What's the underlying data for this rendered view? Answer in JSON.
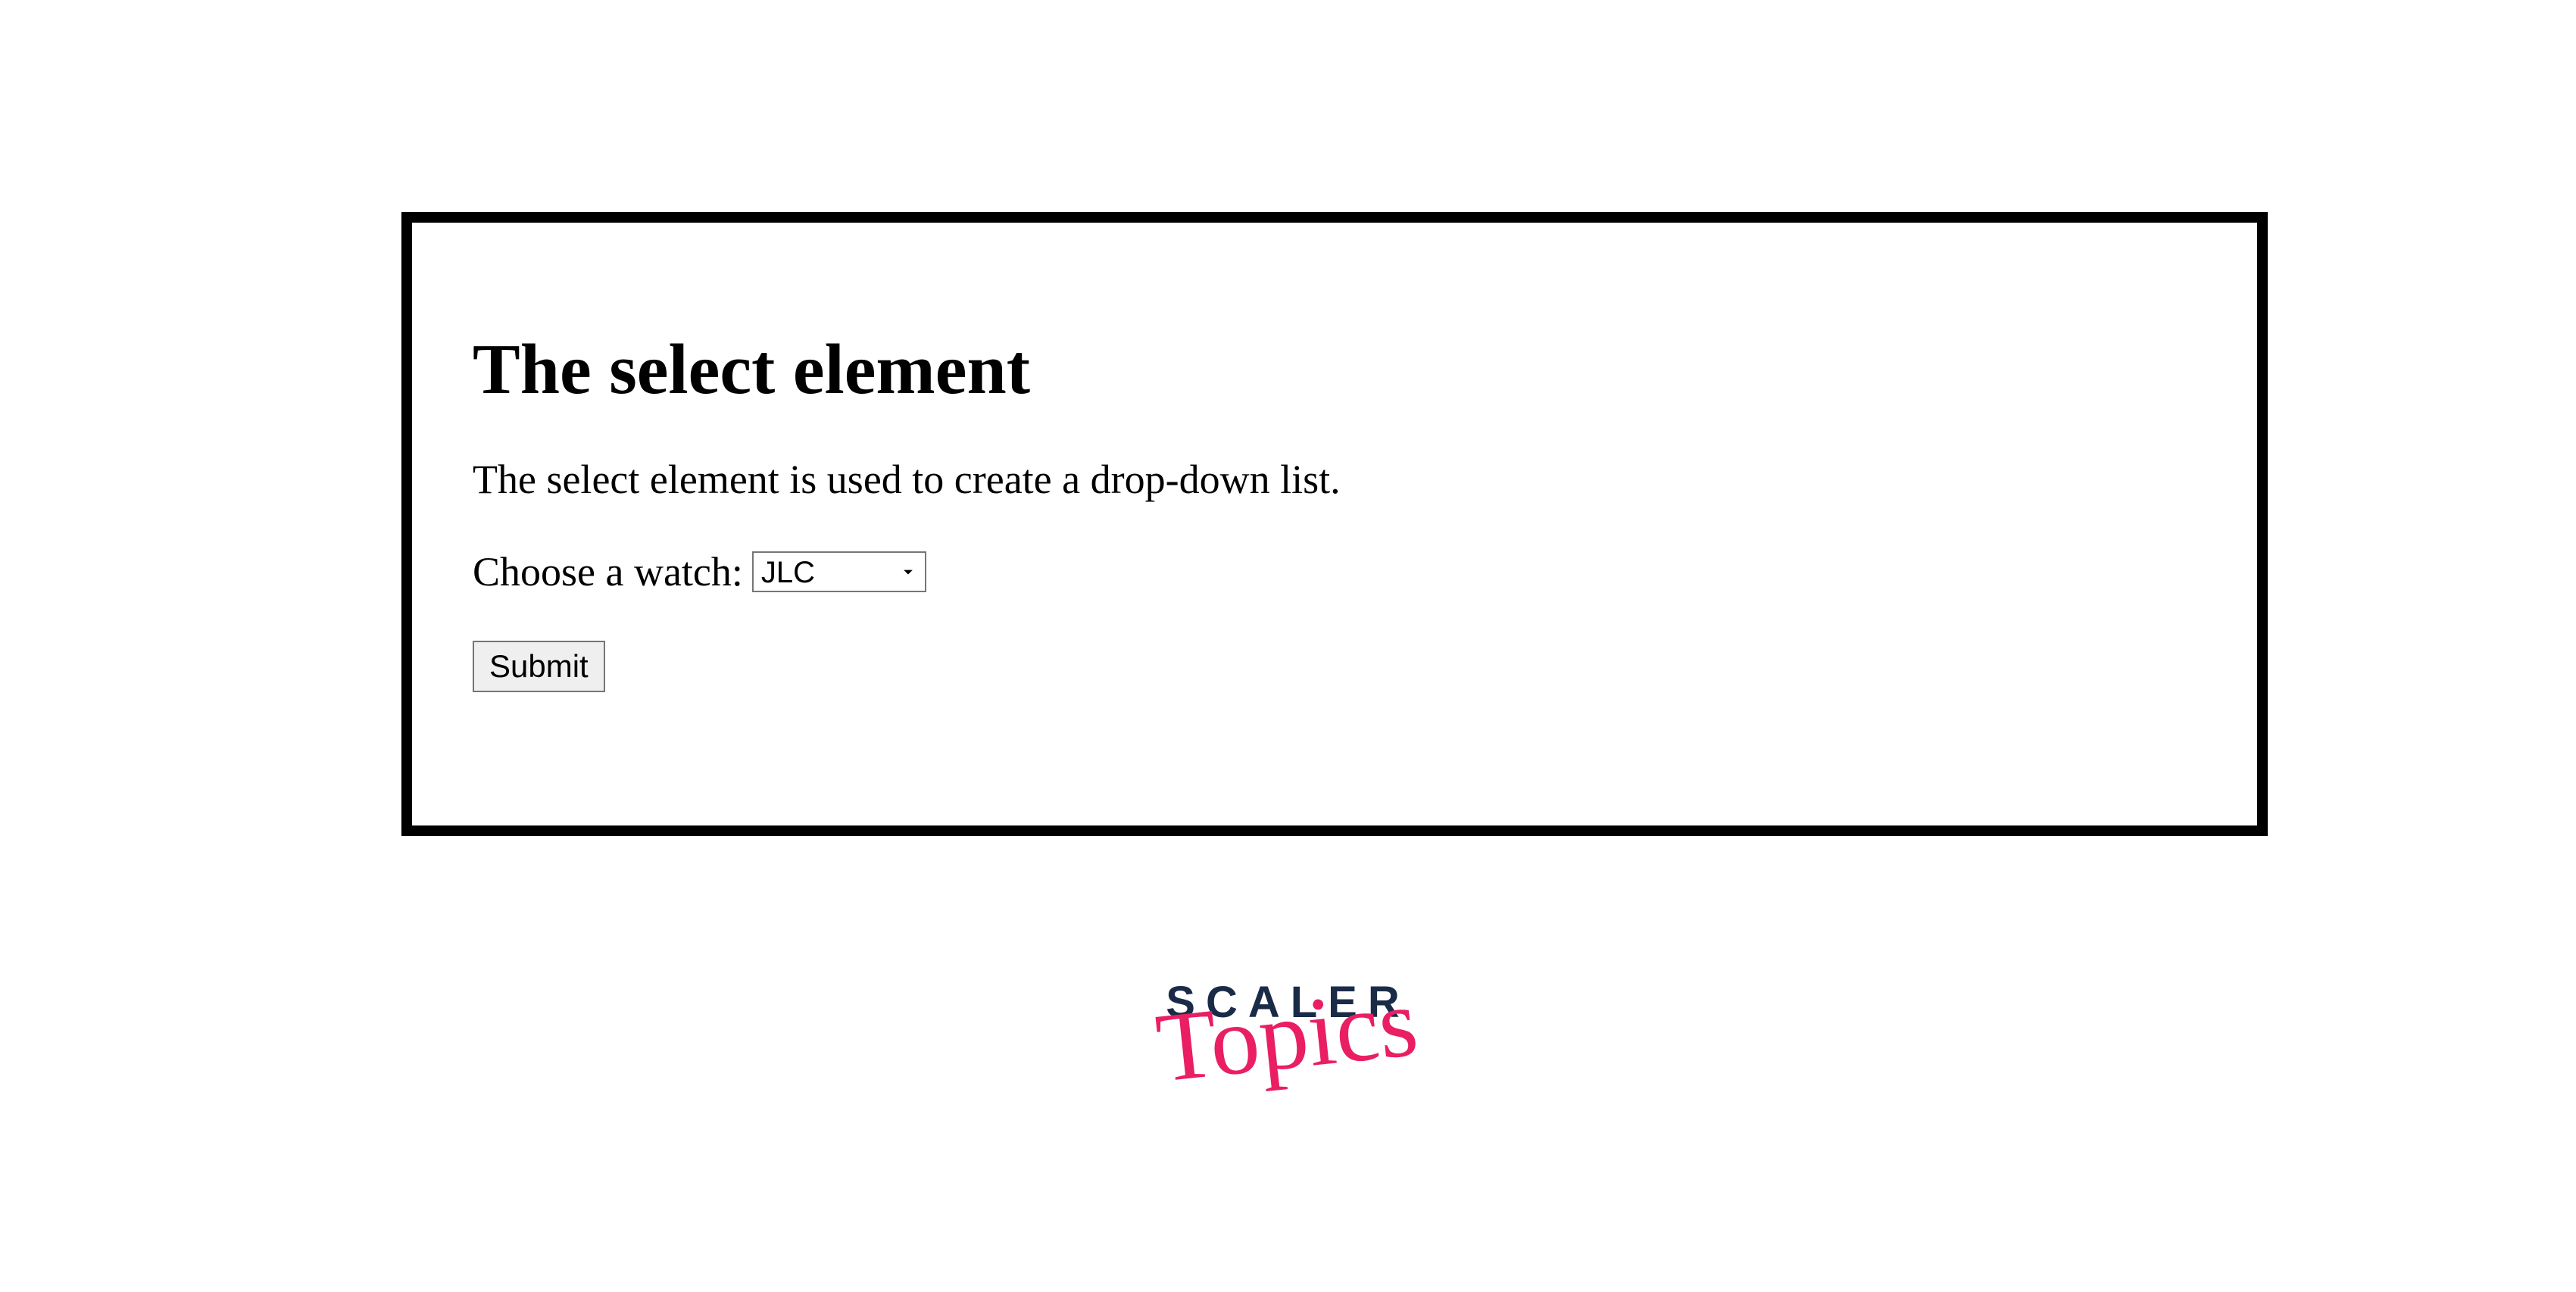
{
  "demo": {
    "heading": "The select element",
    "description": "The select element is used to create a drop-down list.",
    "form": {
      "label": "Choose a watch:",
      "selected_value": "JLC",
      "submit_label": "Submit"
    }
  },
  "logo": {
    "line1": "SCALER",
    "line2": "Topics"
  }
}
